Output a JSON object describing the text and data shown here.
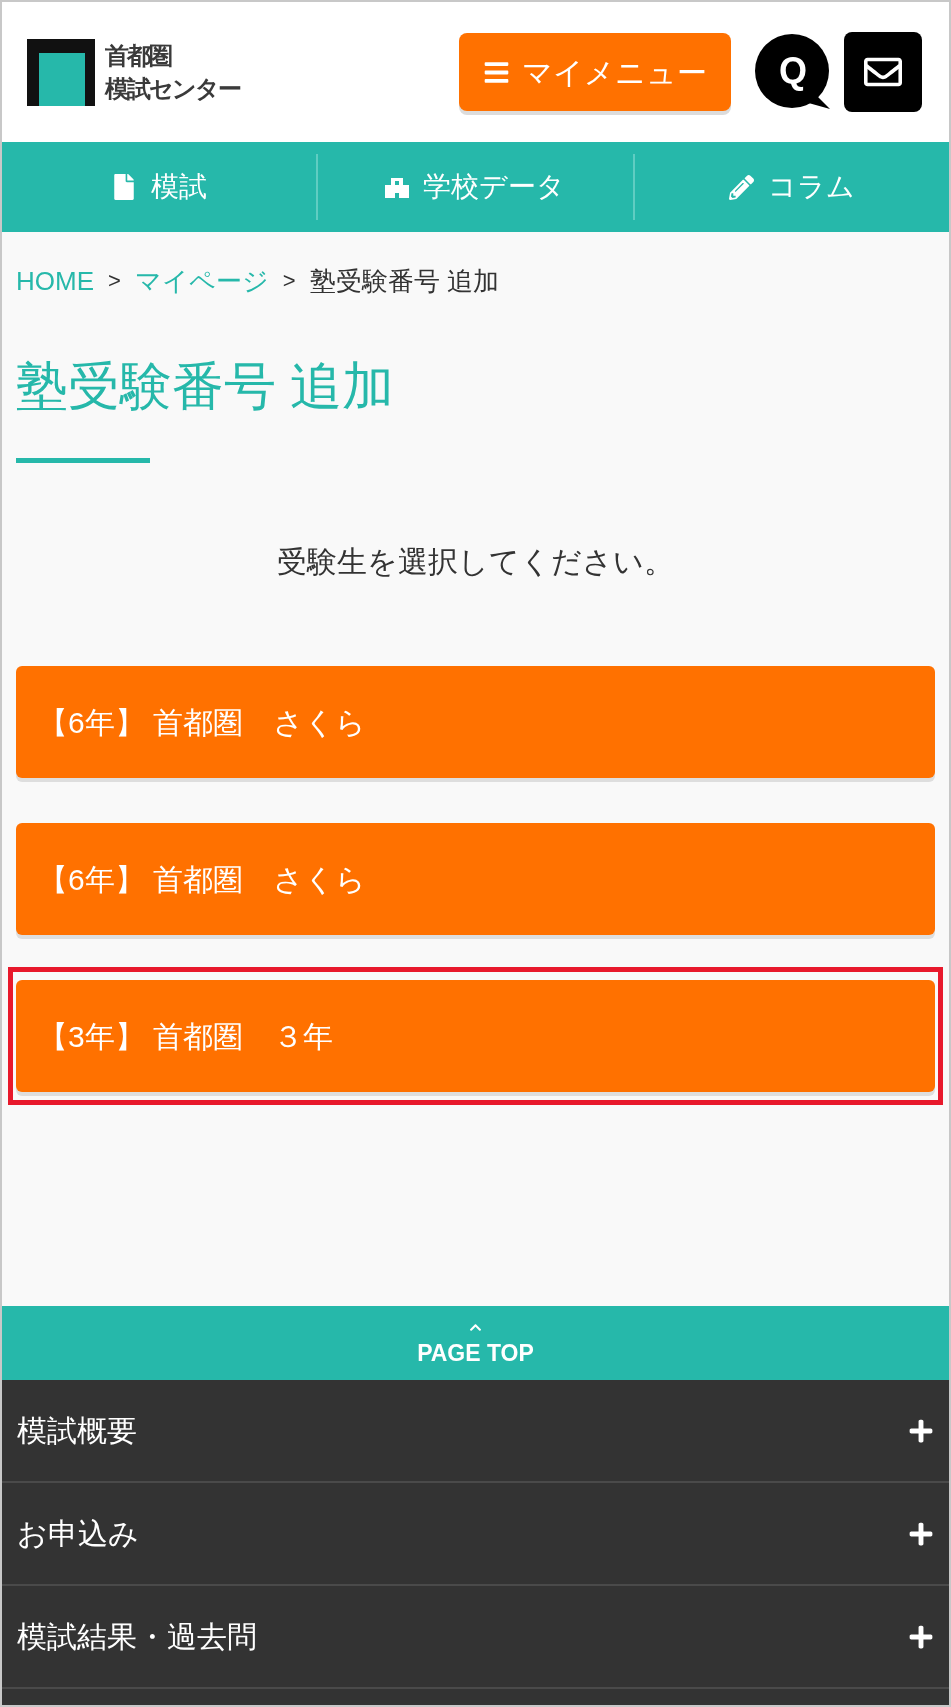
{
  "header": {
    "logo_lines": [
      "首都圏",
      "模試センター"
    ],
    "menu_button": {
      "label": "マイメニュー"
    },
    "faq_button": {
      "label": "Q"
    }
  },
  "nav": [
    {
      "label": "模試"
    },
    {
      "label": "学校データ"
    },
    {
      "label": "コラム"
    }
  ],
  "breadcrumb": [
    {
      "kind": "link",
      "text": "HOME"
    },
    {
      "kind": "separator",
      "text": ">"
    },
    {
      "kind": "link",
      "text": "マイページ"
    },
    {
      "kind": "separator",
      "text": ">"
    },
    {
      "kind": "current",
      "text": "塾受験番号 追加"
    }
  ],
  "page_title": "塾受験番号 追加",
  "lead": "受験生を選択してください。",
  "students": [
    {
      "label": "【6年】 首都圏　さくら",
      "selected": false
    },
    {
      "label": "【6年】 首都圏　さくら",
      "selected": false
    },
    {
      "label": "【3年】 首都圏　３年",
      "selected": true
    }
  ],
  "page_top": {
    "label": "PAGE TOP"
  },
  "footer_menu": [
    {
      "label": "模試概要",
      "expanded": false
    },
    {
      "label": "お申込み",
      "expanded": false
    },
    {
      "label": "模試結果・過去問",
      "expanded": false
    }
  ]
}
